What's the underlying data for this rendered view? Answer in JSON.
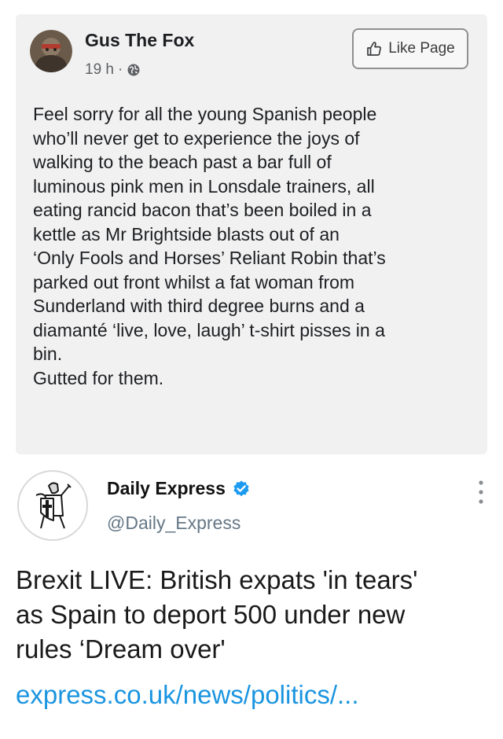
{
  "facebook_post": {
    "page_name": "Gus The Fox",
    "time": "19 h",
    "separator": "·",
    "audience_icon": "globe-icon",
    "like_page_label": "Like Page",
    "like_icon": "thumb-up-icon",
    "body_lines": [
      "Feel sorry for all the young Spanish people",
      "who’ll never get to experience the joys of",
      "walking to the beach past a bar full of",
      "luminous pink men in Lonsdale trainers, all",
      "eating rancid bacon that’s been boiled in a",
      "kettle as Mr Brightside blasts out of an",
      "‘Only Fools and Horses’ Reliant Robin that’s",
      "parked out front whilst a fat woman from",
      "Sunderland with third degree burns and a",
      "diamanté ‘live, love, laugh’ t-shirt pisses in a",
      "bin.",
      "Gutted for them."
    ]
  },
  "tweet": {
    "account_name": "Daily Express",
    "verified_icon": "verified-badge-icon",
    "handle": "@Daily_Express",
    "menu_icon": "more-vertical-icon",
    "headline_lines": [
      "Brexit LIVE: British expats 'in tears'",
      "as Spain to deport 500 under new",
      "rules ‘Dream over'"
    ],
    "link_text": "express.co.uk/news/politics/..."
  },
  "colors": {
    "card_background": "#f1f1f1",
    "link_blue": "#1b95e0",
    "verified_blue": "#1d9bf0",
    "meta_gray": "#5f6164",
    "handle_gray": "#657786"
  }
}
